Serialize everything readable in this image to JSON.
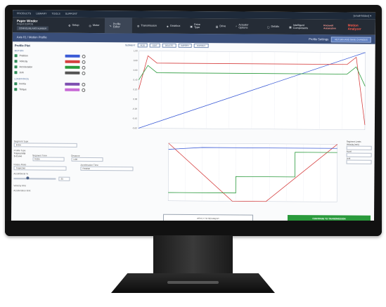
{
  "topbar": {
    "links": [
      "PRODUCTS",
      "LIBRARY",
      "TOOLS",
      "SUPPORT"
    ],
    "account": "[email-hidden] ▾"
  },
  "project": {
    "name": "Paper Winder",
    "subtitle": "Project 01/PDS",
    "button": "CONFIGURE AXIS NUMBER"
  },
  "nav": [
    {
      "label": "Setup",
      "icon": "gear-icon"
    },
    {
      "label": "Motor",
      "icon": "motor-icon"
    },
    {
      "label": "Profile Editor",
      "icon": "profile-icon",
      "active": true
    },
    {
      "label": "Transmission",
      "icon": "gears-icon"
    },
    {
      "label": "Gearbox",
      "icon": "gearbox-icon"
    },
    {
      "label": "Drive Type",
      "icon": "drive-icon"
    },
    {
      "label": "Drive",
      "icon": "drive-box-icon"
    },
    {
      "label": "Actuator Options",
      "icon": "search-icon"
    },
    {
      "label": "Details",
      "icon": "doc-icon"
    },
    {
      "label": "Intelligent Components",
      "icon": "chip-icon"
    }
  ],
  "brand": {
    "logo": "Rockwell Automation",
    "product": "Motion Analyzer"
  },
  "subbar": {
    "breadcrumb": "Axis 01 / Motion Profile",
    "status": "Profile Settings",
    "action": "RETURN AND SAVE CHANGES"
  },
  "profile": {
    "title": "Profile Plot",
    "sec_motion": "MOTION",
    "cols": [
      "COLOR",
      "PLOT"
    ],
    "motion_rows": [
      {
        "label": "Position",
        "color": "#3b5bd6"
      },
      {
        "label": "Velocity",
        "color": "#d64040"
      },
      {
        "label": "Acceleration",
        "color": "#2a9a3c"
      },
      {
        "label": "Jerk",
        "color": "#555555"
      }
    ],
    "sec_load": "LOAD/FORCE",
    "load_rows": [
      {
        "label": "Inertia",
        "color": "#7d4fb0"
      },
      {
        "label": "Torque",
        "color": "#c86ad6"
      }
    ]
  },
  "chart_toolbar": [
    "SEGMENT",
    "ADD",
    "EDIT",
    "DELETE",
    "IMPORT",
    "EXPORT"
  ],
  "chart_main": {
    "ylabel": "Position (in)",
    "yticks": [
      "1.00",
      "0.80",
      "0.60",
      "0.40",
      "0.20",
      "0.00",
      "-0.20",
      "-0.40",
      "-0.60"
    ]
  },
  "form": {
    "label1": "Segment Type",
    "val1": "Index",
    "label2": "Profile Type",
    "opt_a": "Trapezoidal",
    "opt_b": "S-Curve",
    "label3": "Segment Time",
    "val3": "0.025",
    "label4": "Distance",
    "val4": "1.00",
    "label5": "Rotary Ratio",
    "val5": "Trapezoid",
    "label6": "Acceleration Time",
    "val6": "Position",
    "slider_label": "Accel/Decel %",
    "slider_val": "33",
    "sub1": "Velocity limit",
    "sub2": "Acceleration limit"
  },
  "right_panel": {
    "title": "Segment Limits",
    "labels": [
      "Velocity (m/s)",
      "Accel",
      "Jerk"
    ]
  },
  "buttons": {
    "apply": "APPLY TO SEGMENT",
    "continue": "CONTINUE TO TRANSMISSION"
  },
  "chart_data": [
    {
      "type": "line",
      "ylabel": "Position (in)",
      "ylim": [
        -0.6,
        1.0
      ],
      "series": [
        {
          "name": "Position",
          "color": "#3b5bd6",
          "x": [
            0,
            100
          ],
          "y": [
            -0.6,
            1.0
          ]
        },
        {
          "name": "Velocity",
          "color": "#d64040",
          "x": [
            0,
            4,
            8,
            92,
            96,
            100
          ],
          "y": [
            0.2,
            0.9,
            0.75,
            0.75,
            0.9,
            -0.5
          ]
        },
        {
          "name": "Acceleration",
          "color": "#2a9a3c",
          "x": [
            0,
            4,
            8,
            92,
            96,
            100
          ],
          "y": [
            0.4,
            0.7,
            0.55,
            0.55,
            0.7,
            0.3
          ]
        }
      ]
    },
    {
      "type": "line",
      "ylim": [
        -0.4,
        1.0
      ],
      "series": [
        {
          "name": "Velocity",
          "color": "#d64040",
          "x": [
            0,
            38,
            58,
            100
          ],
          "y": [
            1.0,
            -0.4,
            -0.4,
            1.0
          ]
        },
        {
          "name": "Position",
          "color": "#3b5bd6",
          "x": [
            0,
            20,
            100
          ],
          "y": [
            0.85,
            0.9,
            0.9
          ]
        },
        {
          "name": "Acceleration",
          "color": "#2a9a3c",
          "x": [
            0,
            40,
            40,
            75,
            75,
            100
          ],
          "y": [
            -0.2,
            -0.2,
            0.2,
            0.2,
            0.8,
            0.8
          ]
        }
      ]
    }
  ]
}
